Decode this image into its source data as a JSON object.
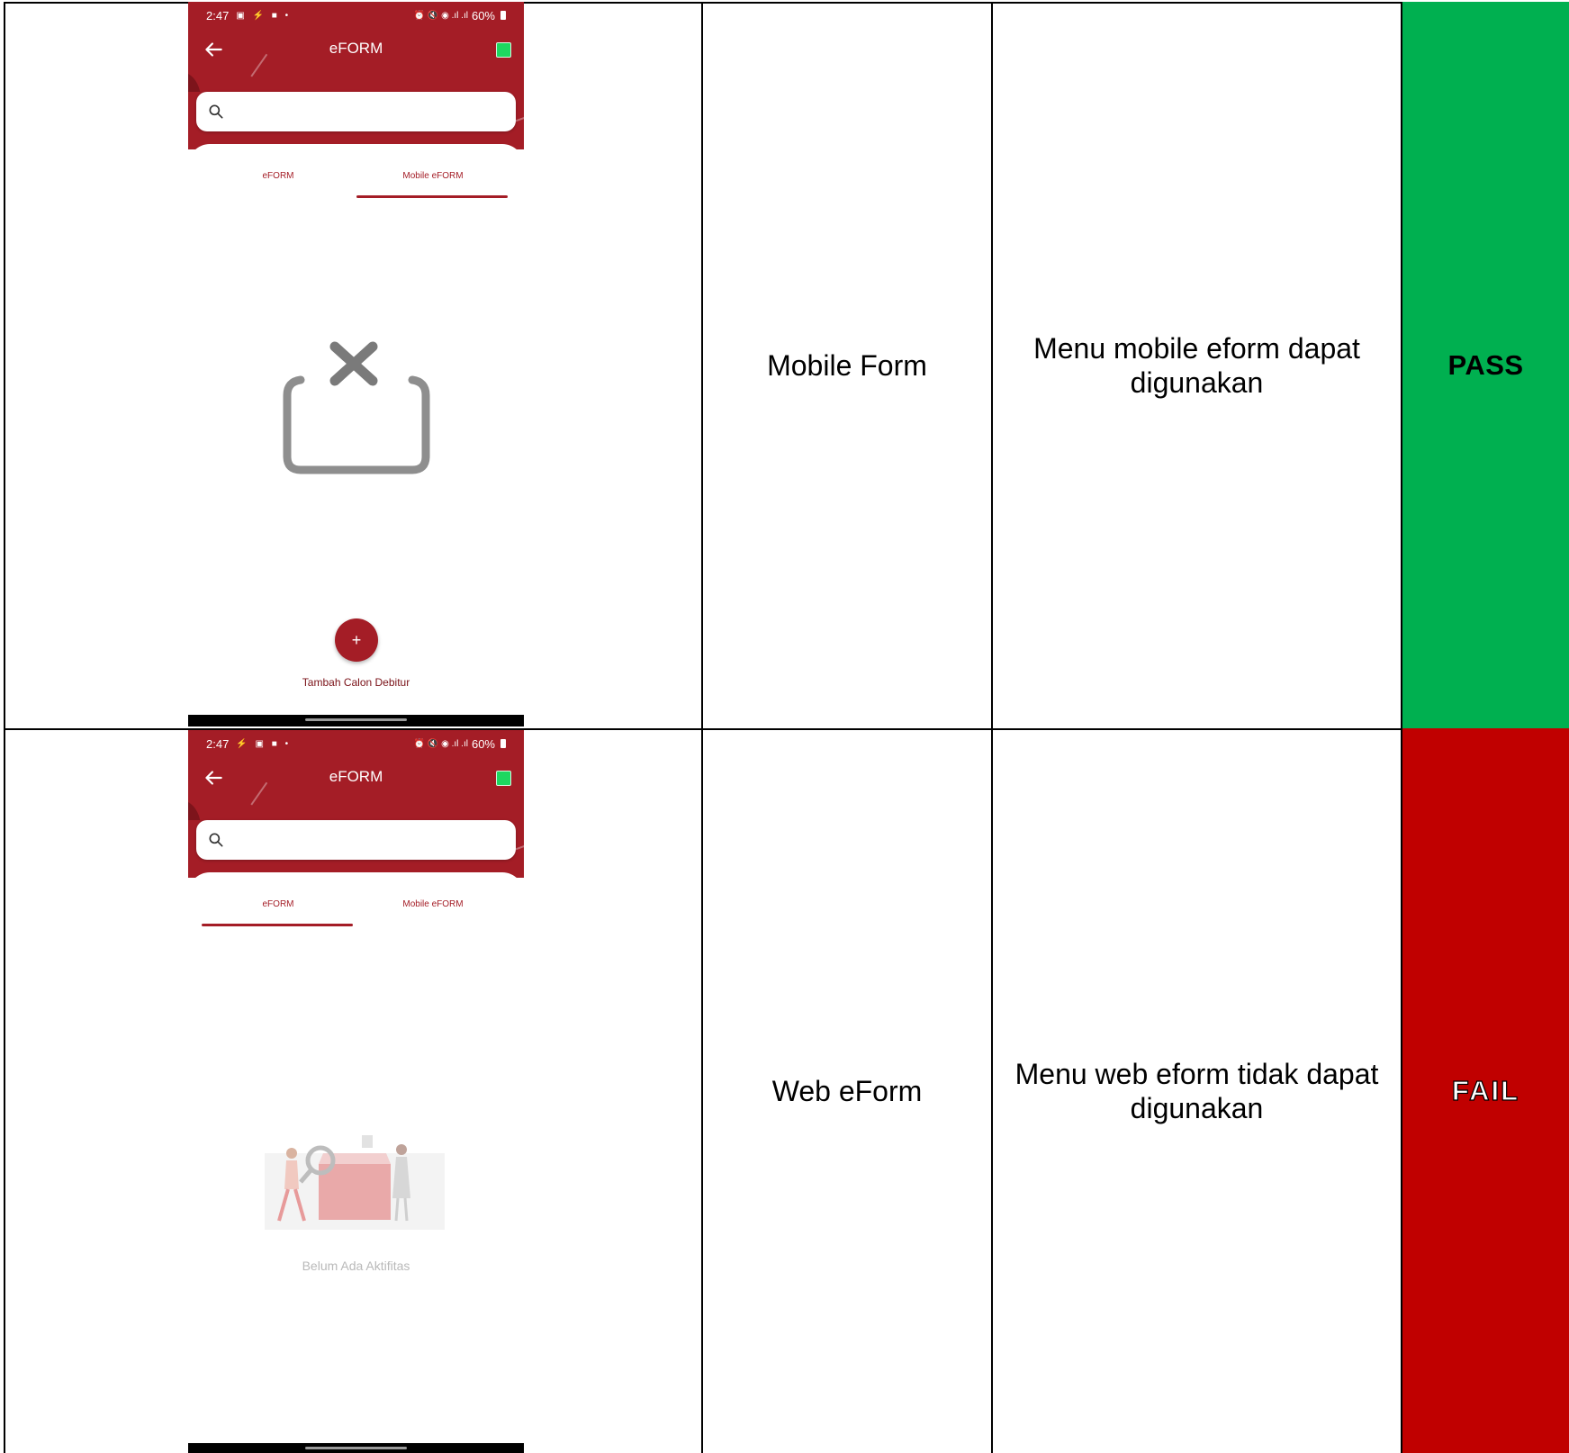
{
  "rows": [
    {
      "screenshot": {
        "statusbar": {
          "time": "2:47",
          "icons_left": "▣ ⚡ ■ •",
          "icons_right": "⏰ 🔇 ◉ .ıl .ıl",
          "battery": "60%"
        },
        "appbar": {
          "title": "eFORM",
          "back_icon": "arrow-left-icon",
          "status_indicator_color": "#1ed760"
        },
        "search": {
          "placeholder": "",
          "icon": "search-icon"
        },
        "tabs": [
          {
            "label": "eFORM",
            "active": false
          },
          {
            "label": "Mobile eFORM",
            "active": true
          }
        ],
        "empty_state_icon": "box-remove-icon",
        "fab": {
          "icon": "+",
          "label": "Tambah Calon Debitur"
        }
      },
      "feature": "Mobile Form",
      "result": "Menu mobile eform dapat digunakan",
      "status": "PASS",
      "status_color": "#00b050"
    },
    {
      "screenshot": {
        "statusbar": {
          "time": "2:47",
          "icons_left": "⚡ ▣ ■ •",
          "icons_right": "⏰ 🔇 ◉ .ıl .ıl",
          "battery": "60%"
        },
        "appbar": {
          "title": "eFORM",
          "back_icon": "arrow-left-icon",
          "status_indicator_color": "#1ed760"
        },
        "search": {
          "placeholder": "",
          "icon": "search-icon"
        },
        "tabs": [
          {
            "label": "eFORM",
            "active": true
          },
          {
            "label": "Mobile eFORM",
            "active": false
          }
        ],
        "empty_state_illustration": "empty-activity-illustration",
        "empty_message": "Belum Ada Aktifitas"
      },
      "feature": "Web eForm",
      "result": "Menu web eform tidak dapat digunakan",
      "status": "FAIL",
      "status_color": "#c00000"
    }
  ],
  "brand_color": "#a41d26"
}
